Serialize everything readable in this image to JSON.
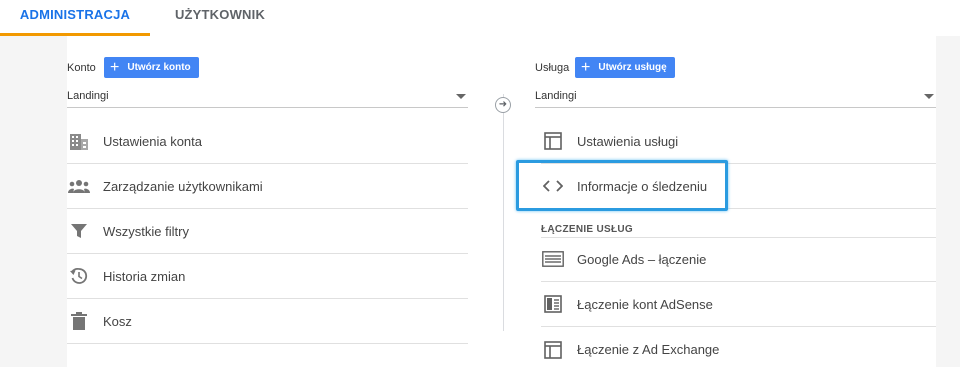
{
  "tabs": [
    {
      "label": "ADMINISTRACJA",
      "active": true
    },
    {
      "label": "UŻYTKOWNIK",
      "active": false
    }
  ],
  "account": {
    "label": "Konto",
    "create_button": "Utwórz konto",
    "selected": "Landingi",
    "items": [
      {
        "label": "Ustawienia konta",
        "icon": "building-icon"
      },
      {
        "label": "Zarządzanie użytkownikami",
        "icon": "people-icon"
      },
      {
        "label": "Wszystkie filtry",
        "icon": "filter-icon"
      },
      {
        "label": "Historia zmian",
        "icon": "history-icon"
      },
      {
        "label": "Kosz",
        "icon": "trash-icon"
      }
    ]
  },
  "property": {
    "label": "Usługa",
    "create_button": "Utwórz usługę",
    "selected": "Landingi",
    "items": [
      {
        "label": "Ustawienia usługi",
        "icon": "window-icon"
      },
      {
        "label": "Informacje o śledzeniu",
        "icon": "code-icon",
        "highlighted": true
      }
    ],
    "section_title": "ŁĄCZENIE USŁUG",
    "links": [
      {
        "label": "Google Ads – łączenie",
        "icon": "google-ads-icon"
      },
      {
        "label": "Łączenie kont AdSense",
        "icon": "adsense-icon"
      },
      {
        "label": "Łączenie z Ad Exchange",
        "icon": "ad-exchange-icon"
      }
    ]
  },
  "colors": {
    "accent": "#1a73e8",
    "tab_underline": "#f29900",
    "button": "#4285f4",
    "highlight": "#2b9be0"
  }
}
